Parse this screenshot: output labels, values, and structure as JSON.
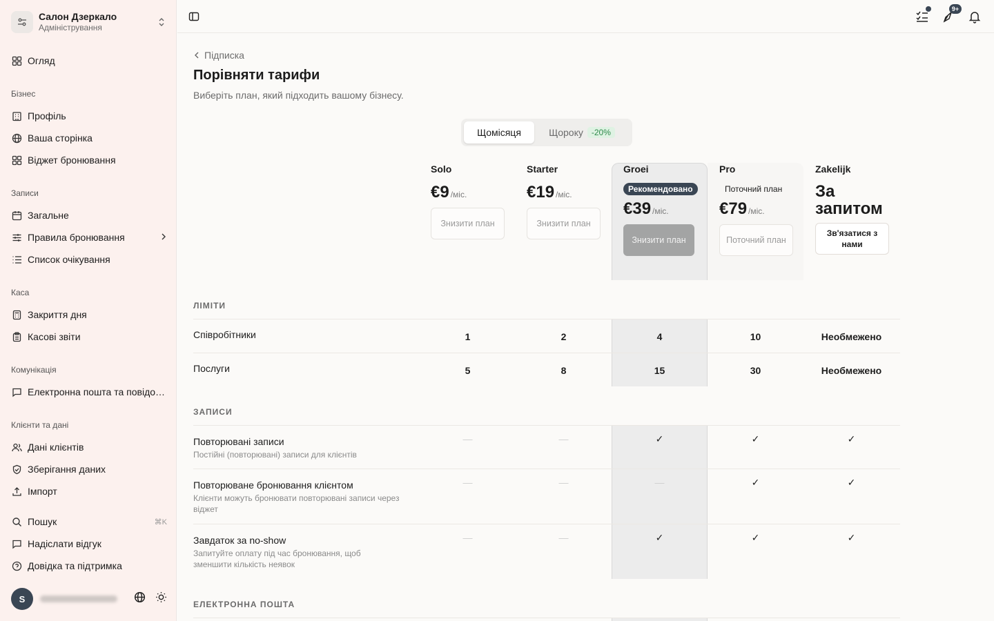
{
  "org": {
    "name": "Салон Дзеркало",
    "role": "Адміністрування"
  },
  "nav": {
    "overview": "Огляд",
    "group_business": "Бізнес",
    "profile": "Профіль",
    "page": "Ваша сторінка",
    "widget": "Віджет бронювання",
    "group_records": "Записи",
    "general": "Загальне",
    "rules": "Правила бронювання",
    "waitlist": "Список очікування",
    "group_cash": "Каса",
    "close_day": "Закриття дня",
    "cash_reports": "Касові звіти",
    "group_comm": "Комунікація",
    "email": "Електронна пошта та повідомлення",
    "group_clients": "Клієнти та дані",
    "client_data": "Дані клієнтів",
    "data_storage": "Зберігання даних",
    "import": "Імпорт",
    "search": "Пошук",
    "search_shortcut": "⌘K",
    "feedback": "Надіслати відгук",
    "help": "Довідка та підтримка"
  },
  "user": {
    "initial": "S"
  },
  "topbar": {
    "badge": "9+"
  },
  "page": {
    "back": "Підписка",
    "title": "Порівняти тарифи",
    "subtitle": "Виберіть план, який підходить вашому бізнесу."
  },
  "billing": {
    "monthly": "Щомісяця",
    "yearly": "Щороку",
    "discount": "-20%"
  },
  "plans": [
    {
      "name": "Solo",
      "price": "€9",
      "unit": "/міс.",
      "button": "Знизити план"
    },
    {
      "name": "Starter",
      "price": "€19",
      "unit": "/міс.",
      "button": "Знизити план"
    },
    {
      "name": "Groei",
      "badge": "Рекомендовано",
      "price": "€39",
      "unit": "/міс.",
      "button": "Знизити план"
    },
    {
      "name": "Pro",
      "badge": "Поточний план",
      "price": "€79",
      "unit": "/міс.",
      "button": "Поточний план"
    },
    {
      "name": "Zakelijk",
      "price": "За запитом",
      "button": "Зв'язатися з нами"
    }
  ],
  "sections": {
    "limits": "ЛІМІТИ",
    "records": "ЗАПИСИ",
    "email": "ЕЛЕКТРОННА ПОШТА"
  },
  "limits": [
    {
      "label": "Співробітники",
      "values": [
        "1",
        "2",
        "4",
        "10",
        "Необмежено"
      ]
    },
    {
      "label": "Послуги",
      "values": [
        "5",
        "8",
        "15",
        "30",
        "Необмежено"
      ]
    }
  ],
  "features": [
    {
      "label": "Повторювані записи",
      "desc": "Постійні (повторювані) записи для клієнтів",
      "values": [
        "—",
        "—",
        "✓",
        "✓",
        "✓"
      ]
    },
    {
      "label": "Повторюване бронювання клієнтом",
      "desc": "Клієнти можуть бронювати повторювані записи через віджет",
      "values": [
        "—",
        "—",
        "—",
        "✓",
        "✓"
      ]
    },
    {
      "label": "Завдаток за no-show",
      "desc": "Запитуйте оплату під час бронювання, щоб зменшити кількість неявок",
      "values": [
        "—",
        "—",
        "✓",
        "✓",
        "✓"
      ]
    }
  ]
}
